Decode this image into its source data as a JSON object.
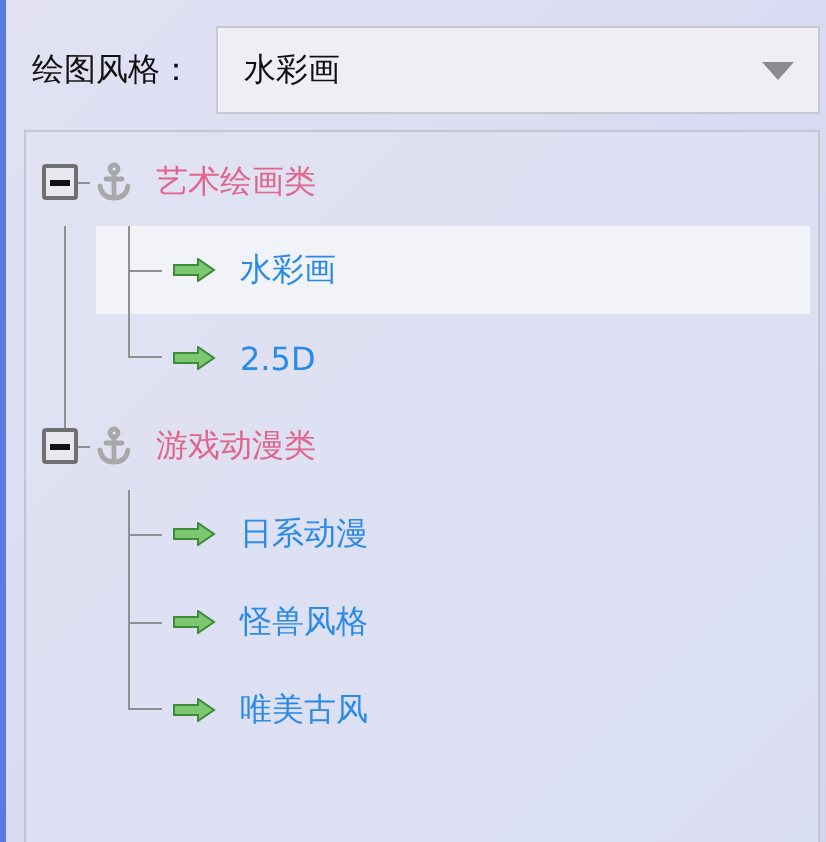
{
  "style_label": "绘图风格：",
  "style_select": {
    "value": "水彩画"
  },
  "tree": [
    {
      "label": "艺术绘画类",
      "expanded": true,
      "children": [
        {
          "label": "水彩画",
          "selected": true
        },
        {
          "label": "2.5D",
          "selected": false
        }
      ]
    },
    {
      "label": "游戏动漫类",
      "expanded": true,
      "children": [
        {
          "label": "日系动漫",
          "selected": false
        },
        {
          "label": "怪兽风格",
          "selected": false
        },
        {
          "label": "唯美古风",
          "selected": false
        }
      ]
    }
  ]
}
